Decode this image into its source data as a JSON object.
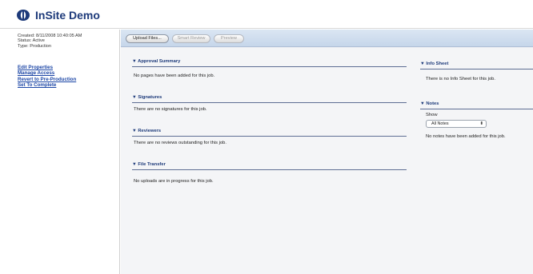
{
  "app": {
    "title": "InSite Demo"
  },
  "sidebar": {
    "created": "Created: 8/11/2008 10:40:05 AM",
    "status": "Status: Active",
    "type": "Type: Production",
    "links": [
      "Edit Properties",
      "Manage Access",
      "Revert to Pre-Production",
      "Set To Complete"
    ]
  },
  "toolbar": {
    "upload_label": "Upload Files...",
    "smart_review_label": "Smart Review",
    "preview_label": "Preview"
  },
  "sections": {
    "approval": {
      "title": "Approval Summary",
      "text": "No pages have been added for this job."
    },
    "signatures": {
      "title": "Signatures",
      "text": "There are no signatures for this job."
    },
    "reviewers": {
      "title": "Reviewers",
      "text": "There are no reviews outstanding for this job."
    },
    "file_transfer": {
      "title": "File Transfer",
      "text": "No uploads are in progress for this job."
    },
    "info_sheet": {
      "title": "Info Sheet",
      "text": "There is no Info Sheet for this job."
    },
    "notes": {
      "title": "Notes",
      "show_label": "Show",
      "selected": "All Notes",
      "text": "No notes have been added for this job."
    }
  },
  "icons": {
    "logo": "insite-logo-icon",
    "disclosure": "triangle-down-icon",
    "select_arrows": "select-arrows-icon"
  },
  "colors": {
    "heading": "#1d3a7a",
    "link": "#1c46a6",
    "toolbar": "#c6d6ea"
  }
}
